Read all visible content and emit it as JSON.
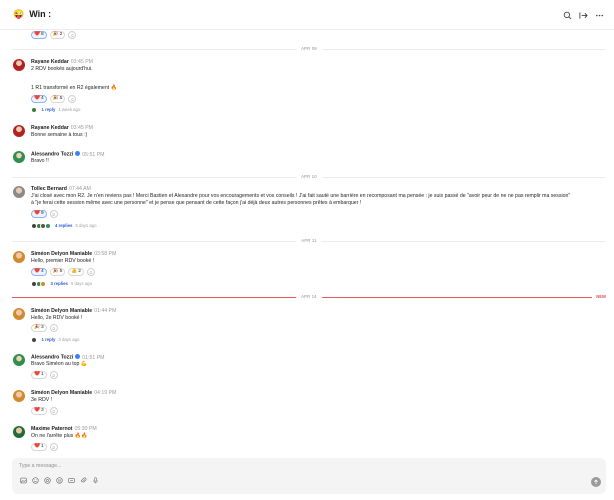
{
  "header": {
    "emoji": "😜",
    "title": "Win :",
    "icons": [
      "search-icon",
      "collapse-right-icon",
      "more-icon"
    ]
  },
  "dividers": [
    {
      "label": "APR 09"
    },
    {
      "label": "APR 10"
    },
    {
      "label": "APR 11"
    },
    {
      "label": "APR 14",
      "new": "NEW"
    }
  ],
  "top_reactions": [
    {
      "emoji": "❤️",
      "count": "8"
    },
    {
      "emoji": "🎉",
      "count": "2"
    }
  ],
  "messages": [
    {
      "author": "Rayane Keddar",
      "time": "03:45 PM",
      "lines": [
        "2 RDV bookés aujourd'hui.",
        "",
        "1 R1 transformé en R2 également 🔥"
      ],
      "reactions": [
        {
          "emoji": "❤️",
          "count": "4"
        },
        {
          "emoji": "🎉",
          "count": "5"
        }
      ],
      "thread": {
        "count": "1 reply",
        "ago": "1 week ago"
      }
    },
    {
      "author": "Rayane Keddar",
      "time": "03:45 PM",
      "lines": [
        "Bonne semaine à tous :)"
      ]
    },
    {
      "author": "Alessandro Tozzi",
      "time": "05:51 PM",
      "verified": true,
      "lines": [
        "Bravo !!"
      ]
    },
    {
      "author": "Tollec Bernard",
      "time": "07:44 AM",
      "lines": [
        "J'ai closé avec mon R2. Je n'en reviens pas ! Merci Bastien et Alexandre pour vos encouragements et vos conseils ! J'ai fait sauté une barrière en recomposant ma pensée : je suis passé de \"avoir peur de ne ne pas remplir ma session\"",
        "à \"je ferai cette session même avec une personne\" et je pense que pensant de cette façon j'ai déjà deux autres personnes prêtes à embarquer !"
      ],
      "reactions": [
        {
          "emoji": "❤️",
          "count": "9"
        }
      ],
      "thread": {
        "count": "4 replies",
        "ago": "5 days ago"
      }
    },
    {
      "author": "Siméon Delyon Maniable",
      "time": "03:58 PM",
      "lines": [
        "Hello, premier RDV booké !"
      ],
      "reactions": [
        {
          "emoji": "❤️",
          "count": "4"
        },
        {
          "emoji": "🎉",
          "count": "5"
        },
        {
          "emoji": "👍",
          "count": "2"
        }
      ],
      "thread": {
        "count": "3 replies",
        "ago": "5 days ago"
      }
    },
    {
      "author": "Siméon Delyon Maniable",
      "time": "01:44 PM",
      "lines": [
        "Hello, 2e RDV booké !"
      ],
      "reactions": [
        {
          "emoji": "🎉",
          "count": "3"
        }
      ],
      "thread": {
        "count": "1 reply",
        "ago": "3 days ago"
      }
    },
    {
      "author": "Alessandro Tozzi",
      "time": "01:51 PM",
      "verified": true,
      "lines": [
        "Bravo Siméon au top 💪"
      ],
      "reactions": [
        {
          "emoji": "❤️",
          "count": "1"
        }
      ]
    },
    {
      "author": "Siméon Delyon Maniable",
      "time": "04:19 PM",
      "lines": [
        "3e RDV !"
      ],
      "reactions": [
        {
          "emoji": "❤️",
          "count": "3"
        }
      ]
    },
    {
      "author": "Maxime Paternot",
      "time": "05:30 PM",
      "lines": [
        "On ne l'arrête plus 🔥🔥"
      ],
      "reactions": [
        {
          "emoji": "❤️",
          "count": "1"
        }
      ]
    }
  ],
  "composer": {
    "placeholder": "Type a message...",
    "tools": [
      "image-icon",
      "emoji-icon",
      "gif-icon",
      "mention-icon",
      "snippet-icon",
      "attach-icon",
      "mic-icon"
    ],
    "send_icon": "send-arrow-icon"
  },
  "colors": {
    "accent": "#2c5bd3",
    "new_divider": "#e45a5a",
    "reaction_mine_border": "#8ab4f8",
    "verified": "#3b82f6"
  }
}
